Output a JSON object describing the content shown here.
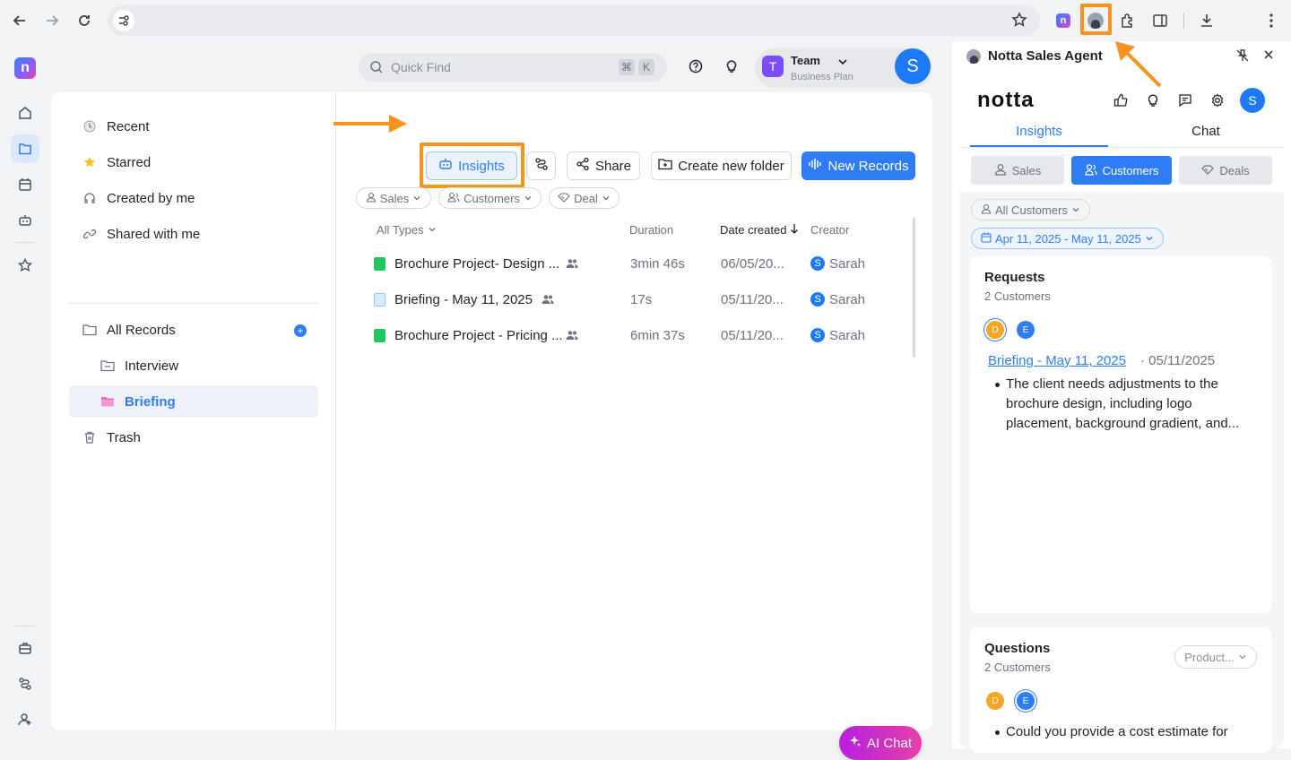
{
  "browser": {
    "back_label": "Back",
    "forward_label": "Forward",
    "reload_label": "Reload"
  },
  "header": {
    "search_placeholder": "Quick Find",
    "kbd1": "⌘",
    "kbd2": "K",
    "team_name": "Team",
    "team_initial": "T",
    "plan": "Business Plan",
    "user_initial": "S"
  },
  "sidebar": {
    "items": [
      {
        "label": "Recent"
      },
      {
        "label": "Starred"
      },
      {
        "label": "Created by me"
      },
      {
        "label": "Shared with me"
      },
      {
        "label": "All Records"
      },
      {
        "label": "Interview"
      },
      {
        "label": "Briefing"
      },
      {
        "label": "Trash"
      }
    ]
  },
  "toolbar": {
    "insights": "Insights",
    "share": "Share",
    "create_folder": "Create new folder",
    "new_records": "New Records"
  },
  "filters": [
    "Sales",
    "Customers",
    "Deal"
  ],
  "table": {
    "headers": {
      "type": "All Types",
      "duration": "Duration",
      "date": "Date created",
      "creator": "Creator"
    },
    "rows": [
      {
        "name": "Brochure Project- Design ...",
        "duration": "3min 46s",
        "date": "06/05/20...",
        "creator": "Sarah",
        "creator_initial": "S"
      },
      {
        "name": "Briefing - May 11, 2025",
        "duration": "17s",
        "date": "05/11/20...",
        "creator": "Sarah",
        "creator_initial": "S"
      },
      {
        "name": "Brochure Project - Pricing ...",
        "duration": "6min 37s",
        "date": "05/11/20...",
        "creator": "Sarah",
        "creator_initial": "S"
      }
    ]
  },
  "ai_chat": "AI Chat",
  "panel": {
    "title": "Notta Sales Agent",
    "brand": "notta",
    "user_initial": "S",
    "tabs": [
      "Insights",
      "Chat"
    ],
    "segments": [
      "Sales",
      "Customers",
      "Deals"
    ],
    "customer_filter": "All Customers",
    "date_range": "Apr 11, 2025 - May 11, 2025",
    "requests": {
      "title": "Requests",
      "count": "2 Customers",
      "dot1": "D",
      "dot2": "E",
      "link": "Briefing - May 11, 2025",
      "date": "· 05/11/2025",
      "bullet": "The client needs adjustments to the brochure design, including logo placement, background gradient, and..."
    },
    "questions": {
      "title": "Questions",
      "count": "2 Customers",
      "dot1": "D",
      "dot2": "E",
      "filter": "Product...",
      "bullet": "Could you provide a cost estimate for"
    }
  },
  "colors": {
    "accent": "#2f7df6",
    "highlight": "#f7941d",
    "ai_gradient_start": "#b620e0",
    "ai_gradient_end": "#e83fa8"
  }
}
